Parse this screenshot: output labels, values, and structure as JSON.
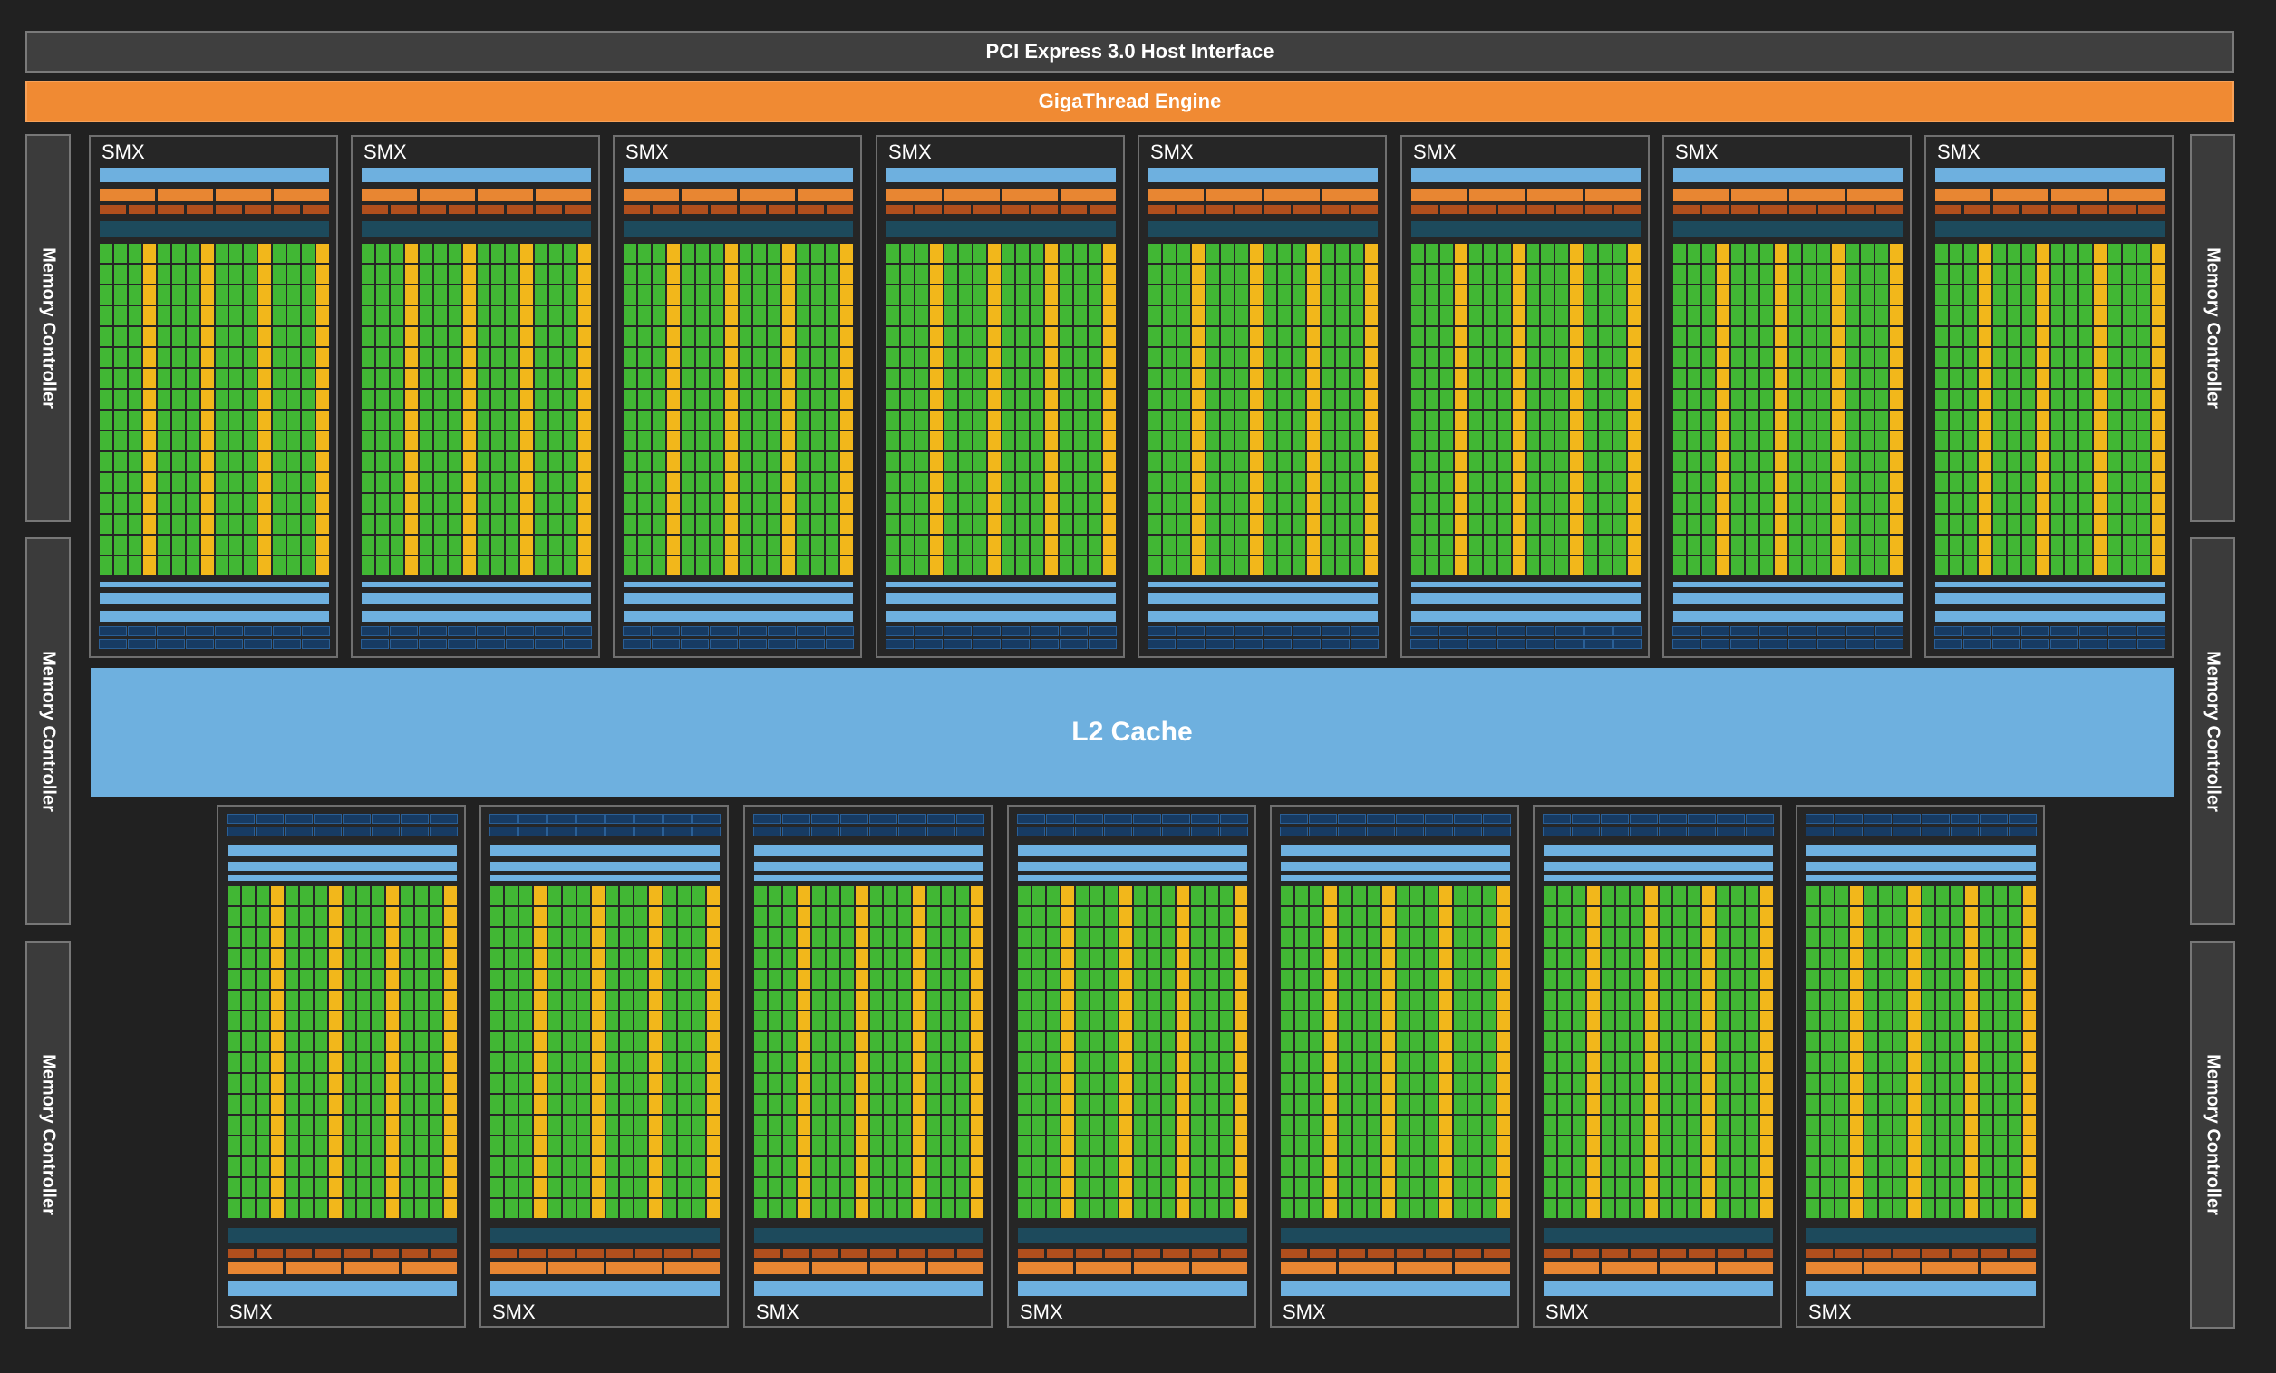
{
  "host_interface": "PCI Express 3.0 Host Interface",
  "gigathread_engine": "GigaThread Engine",
  "l2_cache": "L2 Cache",
  "memory_controller_label": "Memory Controller",
  "smx_label": "SMX",
  "colors": {
    "background": "#212121",
    "host_interface": "#3f3f3f",
    "gigathread_engine": "#f08a33",
    "l2_cache": "#6eb0df",
    "core": "#41b734",
    "special_unit": "#f2b71b",
    "register": "#6eb0df",
    "dark_teal": "#1d4a5c",
    "dispatch": "#e88632",
    "warp": "#b14f1d",
    "texture": "#173b63"
  }
}
